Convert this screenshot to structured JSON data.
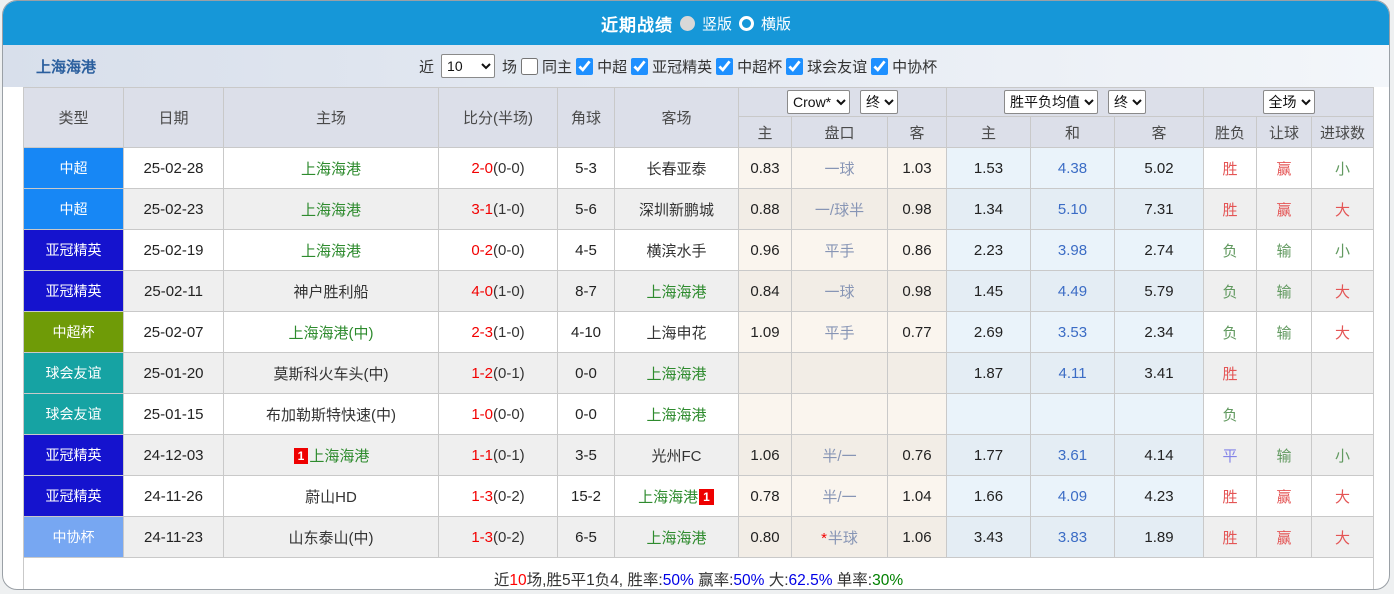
{
  "header": {
    "title": "近期战绩",
    "radio_vertical_label": "竖版",
    "radio_horizontal_label": "横版"
  },
  "filter": {
    "team": "上海海港",
    "near_label": "近",
    "near_value": "10",
    "games_label": "场",
    "same_home_label": "同主",
    "competitions": [
      "中超",
      "亚冠精英",
      "中超杯",
      "球会友谊",
      "中协杯"
    ]
  },
  "table": {
    "selects": {
      "bookmaker": "Crow*",
      "bookmaker_state": "终",
      "avg": "胜平负均值",
      "avg_state": "终",
      "scope": "全场"
    },
    "headers": {
      "type": "类型",
      "date": "日期",
      "home": "主场",
      "score": "比分(半场)",
      "corners": "角球",
      "away": "客场",
      "odds_home": "主",
      "odds_handicap": "盘口",
      "odds_away": "客",
      "avg_home": "主",
      "avg_draw": "和",
      "avg_away": "客",
      "res_wdl": "胜负",
      "res_handicap": "让球",
      "res_goals": "进球数"
    },
    "type_colors": {
      "中超": "#1787f5",
      "亚冠精英": "#1513ce",
      "中超杯": "#6f9b07",
      "球会友谊": "#16a3a3",
      "中协杯": "#77a7f2"
    },
    "rows": [
      {
        "type": "中超",
        "date": "25-02-28",
        "home": "上海海港",
        "home_green": true,
        "home_badge": null,
        "score_ft": "2-0",
        "score_ht": "(0-0)",
        "corners": "5-3",
        "away": "长春亚泰",
        "away_green": false,
        "away_badge": null,
        "odds": [
          "0.83",
          "一球",
          "1.03"
        ],
        "handicap_star": false,
        "avg": [
          "1.53",
          "4.38",
          "5.02"
        ],
        "results": [
          {
            "t": "胜",
            "c": "red"
          },
          {
            "t": "赢",
            "c": "red"
          },
          {
            "t": "小",
            "c": "green"
          }
        ]
      },
      {
        "type": "中超",
        "date": "25-02-23",
        "home": "上海海港",
        "home_green": true,
        "home_badge": null,
        "score_ft": "3-1",
        "score_ht": "(1-0)",
        "corners": "5-6",
        "away": "深圳新鹏城",
        "away_green": false,
        "away_badge": null,
        "odds": [
          "0.88",
          "一/球半",
          "0.98"
        ],
        "handicap_star": false,
        "avg": [
          "1.34",
          "5.10",
          "7.31"
        ],
        "results": [
          {
            "t": "胜",
            "c": "red"
          },
          {
            "t": "赢",
            "c": "red"
          },
          {
            "t": "大",
            "c": "red"
          }
        ]
      },
      {
        "type": "亚冠精英",
        "date": "25-02-19",
        "home": "上海海港",
        "home_green": true,
        "home_badge": null,
        "score_ft": "0-2",
        "score_ht": "(0-0)",
        "corners": "4-5",
        "away": "横滨水手",
        "away_green": false,
        "away_badge": null,
        "odds": [
          "0.96",
          "平手",
          "0.86"
        ],
        "handicap_star": false,
        "avg": [
          "2.23",
          "3.98",
          "2.74"
        ],
        "results": [
          {
            "t": "负",
            "c": "green"
          },
          {
            "t": "输",
            "c": "green"
          },
          {
            "t": "小",
            "c": "green"
          }
        ]
      },
      {
        "type": "亚冠精英",
        "date": "25-02-11",
        "home": "神户胜利船",
        "home_green": false,
        "home_badge": null,
        "score_ft": "4-0",
        "score_ht": "(1-0)",
        "corners": "8-7",
        "away": "上海海港",
        "away_green": true,
        "away_badge": null,
        "odds": [
          "0.84",
          "一球",
          "0.98"
        ],
        "handicap_star": false,
        "avg": [
          "1.45",
          "4.49",
          "5.79"
        ],
        "results": [
          {
            "t": "负",
            "c": "green"
          },
          {
            "t": "输",
            "c": "green"
          },
          {
            "t": "大",
            "c": "red"
          }
        ]
      },
      {
        "type": "中超杯",
        "date": "25-02-07",
        "home": "上海海港(中)",
        "home_green": true,
        "home_badge": null,
        "score_ft": "2-3",
        "score_ht": "(1-0)",
        "corners": "4-10",
        "away": "上海申花",
        "away_green": false,
        "away_badge": null,
        "odds": [
          "1.09",
          "平手",
          "0.77"
        ],
        "handicap_star": false,
        "avg": [
          "2.69",
          "3.53",
          "2.34"
        ],
        "results": [
          {
            "t": "负",
            "c": "green"
          },
          {
            "t": "输",
            "c": "green"
          },
          {
            "t": "大",
            "c": "red"
          }
        ]
      },
      {
        "type": "球会友谊",
        "date": "25-01-20",
        "home": "莫斯科火车头(中)",
        "home_green": false,
        "home_badge": null,
        "score_ft": "1-2",
        "score_ht": "(0-1)",
        "corners": "0-0",
        "away": "上海海港",
        "away_green": true,
        "away_badge": null,
        "odds": [
          "",
          "",
          ""
        ],
        "handicap_star": false,
        "avg": [
          "1.87",
          "4.11",
          "3.41"
        ],
        "results": [
          {
            "t": "胜",
            "c": "red"
          },
          null,
          null
        ]
      },
      {
        "type": "球会友谊",
        "date": "25-01-15",
        "home": "布加勒斯特快速(中)",
        "home_green": false,
        "home_badge": null,
        "score_ft": "1-0",
        "score_ht": "(0-0)",
        "corners": "0-0",
        "away": "上海海港",
        "away_green": true,
        "away_badge": null,
        "odds": [
          "",
          "",
          ""
        ],
        "handicap_star": false,
        "avg": [
          "",
          "",
          ""
        ],
        "results": [
          {
            "t": "负",
            "c": "green"
          },
          null,
          null
        ]
      },
      {
        "type": "亚冠精英",
        "date": "24-12-03",
        "home": "上海海港",
        "home_green": true,
        "home_badge": "1",
        "score_ft": "1-1",
        "score_ht": "(0-1)",
        "corners": "3-5",
        "away": "光州FC",
        "away_green": false,
        "away_badge": null,
        "odds": [
          "1.06",
          "半/一",
          "0.76"
        ],
        "handicap_star": false,
        "avg": [
          "1.77",
          "3.61",
          "4.14"
        ],
        "results": [
          {
            "t": "平",
            "c": "blue"
          },
          {
            "t": "输",
            "c": "green"
          },
          {
            "t": "小",
            "c": "green"
          }
        ]
      },
      {
        "type": "亚冠精英",
        "date": "24-11-26",
        "home": "蔚山HD",
        "home_green": false,
        "home_badge": null,
        "score_ft": "1-3",
        "score_ht": "(0-2)",
        "corners": "15-2",
        "away": "上海海港",
        "away_green": true,
        "away_badge": "1",
        "odds": [
          "0.78",
          "半/一",
          "1.04"
        ],
        "handicap_star": false,
        "avg": [
          "1.66",
          "4.09",
          "4.23"
        ],
        "results": [
          {
            "t": "胜",
            "c": "red"
          },
          {
            "t": "赢",
            "c": "red"
          },
          {
            "t": "大",
            "c": "red"
          }
        ]
      },
      {
        "type": "中协杯",
        "date": "24-11-23",
        "home": "山东泰山(中)",
        "home_green": false,
        "home_badge": null,
        "score_ft": "1-3",
        "score_ht": "(0-2)",
        "corners": "6-5",
        "away": "上海海港",
        "away_green": true,
        "away_badge": null,
        "odds": [
          "0.80",
          "半球",
          "1.06"
        ],
        "handicap_star": true,
        "avg": [
          "3.43",
          "3.83",
          "1.89"
        ],
        "results": [
          {
            "t": "胜",
            "c": "red"
          },
          {
            "t": "赢",
            "c": "red"
          },
          {
            "t": "大",
            "c": "red"
          }
        ]
      }
    ]
  },
  "footer": {
    "parts": [
      {
        "t": "近"
      },
      {
        "t": "10",
        "c": "red"
      },
      {
        "t": "场,胜5平1负4, 胜率:"
      },
      {
        "t": "50%",
        "c": "blue"
      },
      {
        "t": " 赢率:"
      },
      {
        "t": "50%",
        "c": "blue"
      },
      {
        "t": " 大:"
      },
      {
        "t": "62.5%",
        "c": "blue"
      },
      {
        "t": " 单率:"
      },
      {
        "t": "30%",
        "c": "green"
      }
    ]
  }
}
